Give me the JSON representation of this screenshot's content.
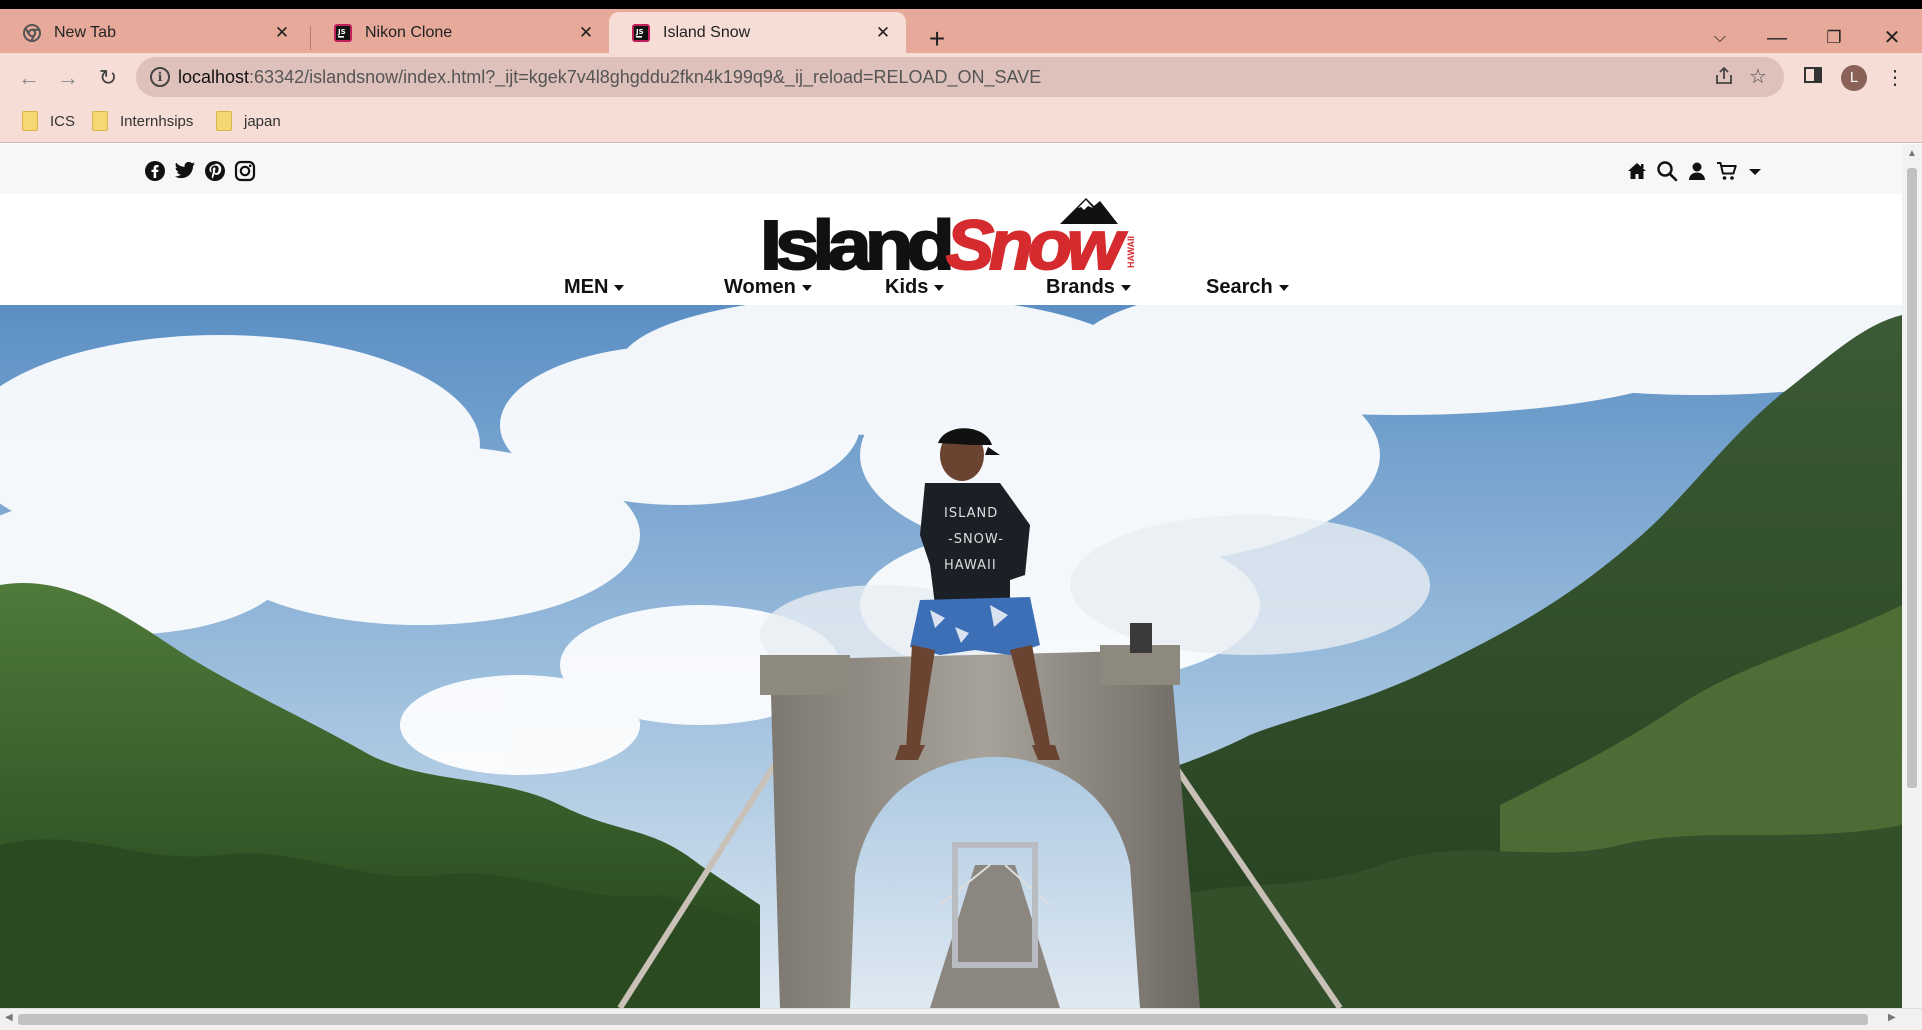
{
  "browser": {
    "tabs": [
      {
        "title": "New Tab"
      },
      {
        "title": "Nikon Clone"
      },
      {
        "title": "Island Snow"
      }
    ],
    "address": {
      "host": "localhost",
      "rest": ":63342/islandsnow/index.html?_ijt=kgek7v4l8ghgddu2fkn4k199q9&_ij_reload=RELOAD_ON_SAVE"
    },
    "profile_initial": "L",
    "bookmarks": [
      {
        "label": "ICS"
      },
      {
        "label": "Internhsips"
      },
      {
        "label": "japan"
      }
    ]
  },
  "site": {
    "logo": {
      "word1": "Island",
      "word2": "Snow",
      "tag": "HAWAII"
    },
    "nav": [
      {
        "label": "MEN"
      },
      {
        "label": "Women"
      },
      {
        "label": "Kids"
      },
      {
        "label": "Brands"
      },
      {
        "label": "Search"
      }
    ],
    "hero": {
      "shirt_lines": [
        "ISLAND",
        "-SNOW-",
        "HAWAII"
      ]
    }
  },
  "colors": {
    "tab_bar": "#e6a99a",
    "toolbar": "#f6ddd6",
    "omnibox": "#ddc1ba",
    "logo_red": "#d52b2e",
    "logo_black": "#111111"
  }
}
